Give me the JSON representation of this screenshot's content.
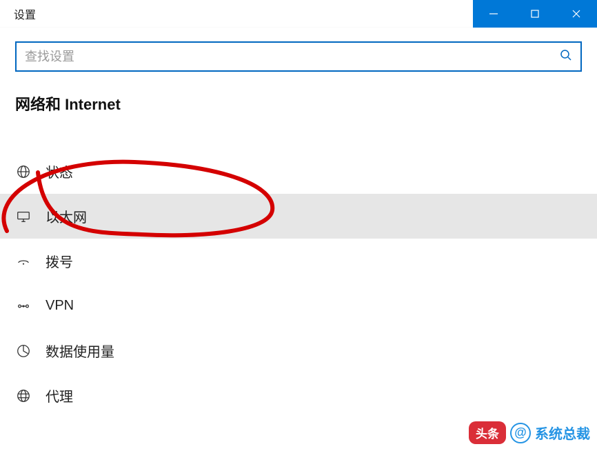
{
  "window": {
    "title": "设置"
  },
  "search": {
    "placeholder": "查找设置"
  },
  "section": {
    "heading": "网络和 Internet"
  },
  "nav": {
    "items": [
      {
        "icon": "status-icon",
        "label": "状态",
        "selected": false
      },
      {
        "icon": "ethernet-icon",
        "label": "以太网",
        "selected": true
      },
      {
        "icon": "dialup-icon",
        "label": "拨号",
        "selected": false
      },
      {
        "icon": "vpn-icon",
        "label": "VPN",
        "selected": false
      },
      {
        "icon": "datausage-icon",
        "label": "数据使用量",
        "selected": false
      },
      {
        "icon": "proxy-icon",
        "label": "代理",
        "selected": false
      }
    ]
  },
  "watermark": {
    "badge": "头条",
    "at": "@",
    "text": "系统总裁"
  }
}
